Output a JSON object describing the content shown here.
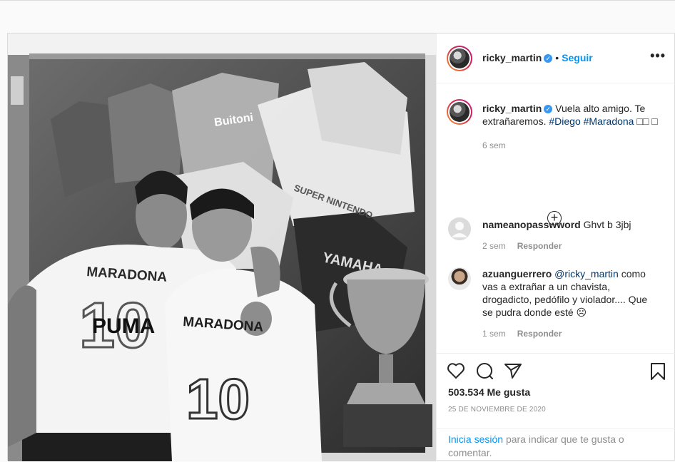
{
  "post": {
    "username": "ricky_martin",
    "follow_label": "Seguir",
    "separator": "•",
    "more_label": "•••",
    "caption": {
      "text": "Vuela alto amigo. Te extrañaremos.",
      "hashtag1": "#Diego",
      "hashtag2": "#Maradona",
      "trailing": "□□ □",
      "time": "6 sem"
    },
    "load_more_label": "+"
  },
  "comments": [
    {
      "username": "nameanopasswword",
      "text": "Ghvt b 3jbj",
      "time": "2 sem",
      "reply_label": "Responder"
    },
    {
      "username": "azuanguerrero",
      "mention": "@ricky_martin",
      "text": "como vas a extrañar a un chavista, drogadicto, pedófilo y violador.... Que se pudra donde esté ☹",
      "time": "1 sem",
      "reply_label": "Responder"
    }
  ],
  "actions": {
    "likes": "503.534 Me gusta",
    "date": "25 DE NOVIEMBRE DE 2020"
  },
  "login_prompt": {
    "link": "Inicia sesión",
    "text": "para indicar que te gusta o comentar."
  },
  "photo": {
    "shirt_text_left": "MARADONA",
    "shirt_number": "10",
    "shirt_brand": "PUMA",
    "shirt_text_right": "MARADONA",
    "jersey_sponsor": "Buitoni",
    "jersey_white_text": "SUPER NINTENDO",
    "jersey_dark_text": "YAMAHA"
  },
  "colors": {
    "link": "#0095f6",
    "hashtag": "#00376b",
    "verified": "#3897f0",
    "muted": "#8e8e8e"
  }
}
